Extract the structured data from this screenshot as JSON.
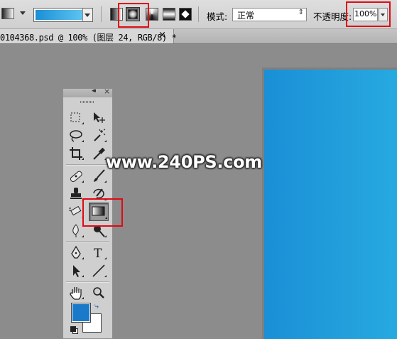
{
  "options_bar": {
    "gradient_types": [
      "linear-gradient",
      "radial-gradient",
      "angle-gradient",
      "reflected-gradient",
      "diamond-gradient"
    ],
    "selected_gradient_type": "radial-gradient",
    "gradient_colors": [
      "#1a8fd6",
      "#5ec4f0"
    ],
    "mode_label": "模式:",
    "mode_value": "正常",
    "opacity_label": "不透明度:",
    "opacity_value": "100%"
  },
  "document_tab": {
    "title": "0104368.psd @ 100% (图层 24, RGB/8) *",
    "close": "×"
  },
  "toolbox": {
    "collapse": "◂◂",
    "close": "×",
    "active_tool": "gradient-tool",
    "foreground_color": "#1a79c8",
    "background_color": "#ffffff"
  },
  "watermark": "www.240PS.com",
  "highlight_color": "#e00a14"
}
